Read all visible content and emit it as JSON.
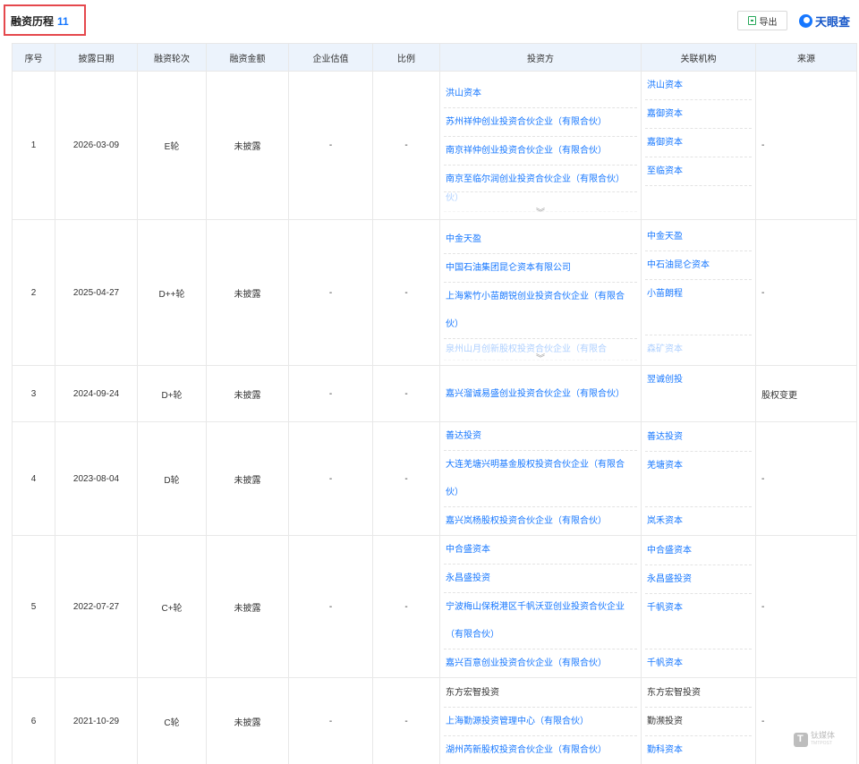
{
  "header": {
    "title": "融资历程",
    "count": "11",
    "export_label": "导出",
    "brand": "天眼查"
  },
  "columns": [
    "序号",
    "披露日期",
    "融资轮次",
    "融资金额",
    "企业估值",
    "比例",
    "投资方",
    "关联机构",
    "来源"
  ],
  "rows": [
    {
      "no": "1",
      "date": "2026-03-09",
      "round": "E轮",
      "amount": "未披露",
      "valuation": "-",
      "ratio": "-",
      "source": "-",
      "investors": [
        "洪山资本",
        "苏州祥仲创业投资合伙企业（有限合伙）",
        "南京祥仲创业投资合伙企业（有限合伙）",
        "南京至临尔润创业投资合伙企业（有限合伙）"
      ],
      "orgs": [
        "洪山资本",
        "嘉御资本",
        "嘉御资本",
        "至临资本"
      ]
    },
    {
      "no": "2",
      "date": "2025-04-27",
      "round": "D++轮",
      "amount": "未披露",
      "valuation": "-",
      "ratio": "-",
      "source": "-",
      "investors": [
        "中金天盈",
        "中国石油集团昆仑资本有限公司",
        "上海紫竹小苗朗锐创业投资合伙企业（有限合伙）",
        "泉州山月创新股权投资合伙企业（有限合"
      ],
      "orgs": [
        "中金天盈",
        "中石油昆仑资本",
        "小苗朗程",
        "森矿资本"
      ]
    },
    {
      "no": "3",
      "date": "2024-09-24",
      "round": "D+轮",
      "amount": "未披露",
      "valuation": "-",
      "ratio": "-",
      "source": "股权变更",
      "investors": [
        "嘉兴溜诚易盛创业投资合伙企业（有限合伙）"
      ],
      "orgs": [
        "翌诚创投"
      ]
    },
    {
      "no": "4",
      "date": "2023-08-04",
      "round": "D轮",
      "amount": "未披露",
      "valuation": "-",
      "ratio": "-",
      "source": "-",
      "investors": [
        "善达投资",
        "大连羌塘兴明基金股权投资合伙企业（有限合伙）",
        "嘉兴岚杨股权投资合伙企业（有限合伙）"
      ],
      "orgs": [
        "善达投资",
        "羌塘资本",
        "岚禾资本"
      ]
    },
    {
      "no": "5",
      "date": "2022-07-27",
      "round": "C+轮",
      "amount": "未披露",
      "valuation": "-",
      "ratio": "-",
      "source": "-",
      "investors": [
        "中合盛资本",
        "永昌盛投资",
        "宁波梅山保税港区千帆沃亚创业投资合伙企业（有限合伙）",
        "嘉兴百意创业投资合伙企业（有限合伙）"
      ],
      "orgs": [
        "中合盛资本",
        "永昌盛投资",
        "千帆资本",
        "千帆资本"
      ]
    },
    {
      "no": "6",
      "date": "2021-10-29",
      "round": "C轮",
      "amount": "未披露",
      "valuation": "-",
      "ratio": "-",
      "source": "-",
      "investors": [
        "东方宏智投资",
        "上海勤源投资管理中心（有限合伙）",
        "湖州芮新股权投资合伙企业（有限合伙）"
      ],
      "orgs": [
        "东方宏智投资",
        "勤濒投资",
        "勤科资本"
      ]
    }
  ],
  "watermark": {
    "name": "钛媒体",
    "sub": "TMTPOST"
  }
}
